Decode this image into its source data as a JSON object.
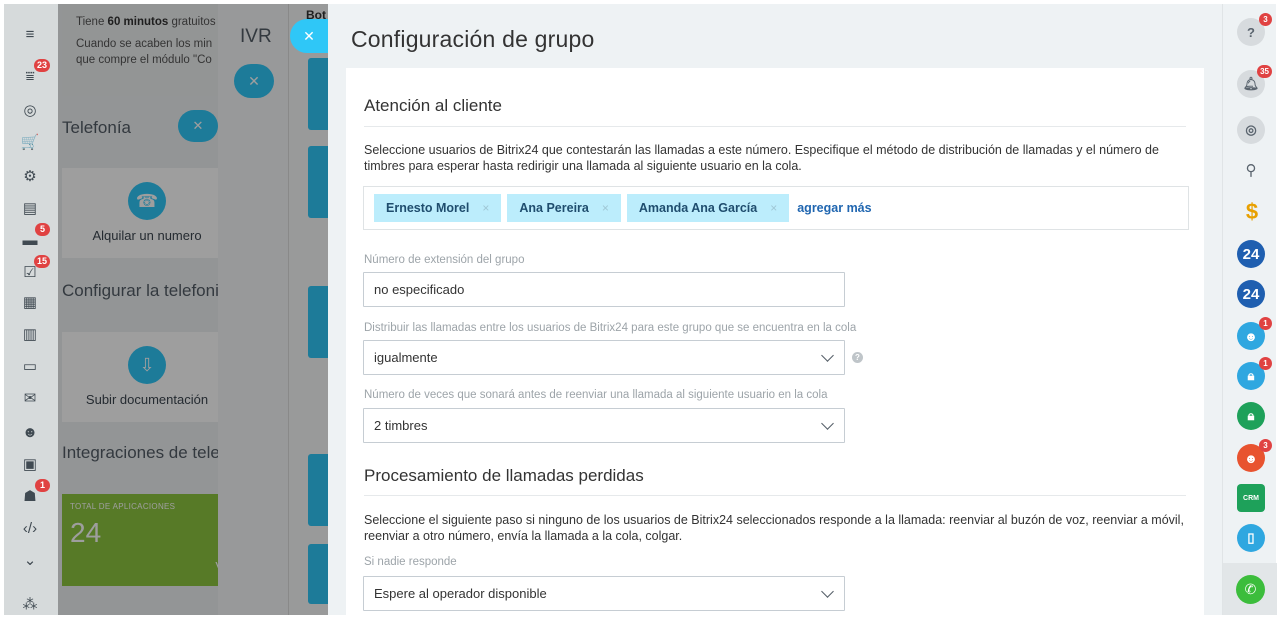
{
  "left_nav": {
    "items": [
      {
        "name": "menu-icon",
        "glyph": "≡",
        "badge": ""
      },
      {
        "name": "filter-icon",
        "glyph": "⩸",
        "badge": "23"
      },
      {
        "name": "target-icon",
        "glyph": "◎",
        "badge": ""
      },
      {
        "name": "cart-icon",
        "glyph": "🛒",
        "badge": ""
      },
      {
        "name": "cog-icon",
        "glyph": "⚙",
        "badge": ""
      },
      {
        "name": "feed-icon",
        "glyph": "▤",
        "badge": ""
      },
      {
        "name": "chat-icon",
        "glyph": "▬",
        "badge": "5"
      },
      {
        "name": "tasks-icon",
        "glyph": "☑",
        "badge": "15"
      },
      {
        "name": "calendar-icon",
        "glyph": "▦",
        "badge": ""
      },
      {
        "name": "document-icon",
        "glyph": "▥",
        "badge": ""
      },
      {
        "name": "drive-icon",
        "glyph": "▭",
        "badge": ""
      },
      {
        "name": "mail-icon",
        "glyph": "✉",
        "badge": ""
      },
      {
        "name": "contacts-icon",
        "glyph": "☻",
        "badge": ""
      },
      {
        "name": "contact-center-icon",
        "glyph": "▣",
        "badge": ""
      },
      {
        "name": "robot-icon",
        "glyph": "☗",
        "badge": "1"
      },
      {
        "name": "code-icon",
        "glyph": "‹/›",
        "badge": ""
      },
      {
        "name": "more-icon",
        "glyph": "⌄",
        "badge": ""
      },
      {
        "name": "sitemap-icon",
        "glyph": "⁂",
        "badge": ""
      }
    ]
  },
  "background": {
    "notice_line1_prefix": "Tiene ",
    "notice_minutes": "60 minutos",
    "notice_line1_suffix": " gratuitos",
    "notice_line2": "Cuando se acaben los min",
    "notice_line3": "que compre el módulo \"Co",
    "telefonia": "Telefonía",
    "rent_number": "Alquilar un numero",
    "configure_title": "Configurar la telefoni",
    "upload_docs": "Subir documentación",
    "integrations_title": "Integraciones de tele",
    "total_apps_label": "TOTAL DE APLICACIONES",
    "total_apps_value": "24",
    "total_apps_side": "V",
    "ivr_title": "IVR",
    "bot_label": "Bot"
  },
  "slider": {
    "title": "Configuración de grupo",
    "section1_title": "Atención al cliente",
    "section1_desc": "Seleccione usuarios de Bitrix24 que contestarán las llamadas a este número. Especifique el método de distribución de llamadas y el número de timbres para esperar hasta redirigir una llamada al siguiente usuario en la cola.",
    "users": [
      "Ernesto Morel",
      "Ana Pereira",
      "Amanda Ana García"
    ],
    "remove_glyph": "×",
    "add_more": "agregar más",
    "ext_label": "Número de extensión del grupo",
    "ext_value": "no especificado",
    "dist_label": "Distribuir las llamadas entre los usuarios de Bitrix24 para este grupo que se encuentra en la cola",
    "dist_value": "igualmente",
    "rings_label": "Número de veces que sonará antes de reenviar una llamada al siguiente usuario en la cola",
    "rings_value": "2 timbres",
    "section2_title": "Procesamiento de llamadas perdidas",
    "section2_desc": "Seleccione el siguiente paso si ninguno de los usuarios de Bitrix24 seleccionados responde a la llamada: reenviar al buzón de voz, reenviar a móvil, reenviar a otro número, envía la llamada a la cola, colgar.",
    "noanswer_label": "Si nadie responde",
    "noanswer_value": "Espere al operador disponible"
  },
  "right_bar": {
    "help_badge": "3",
    "notifications_badge": "35",
    "open_lines_1_label": "24",
    "open_lines_2_label": "24",
    "users_badge": "1",
    "lock_badge": "1",
    "group_badge": "3",
    "crm_label": "CRM"
  },
  "colors": {
    "accent": "#2fc7f7",
    "chip_bg": "#bcedfc",
    "link": "#2066b0",
    "badge": "#e04242"
  }
}
